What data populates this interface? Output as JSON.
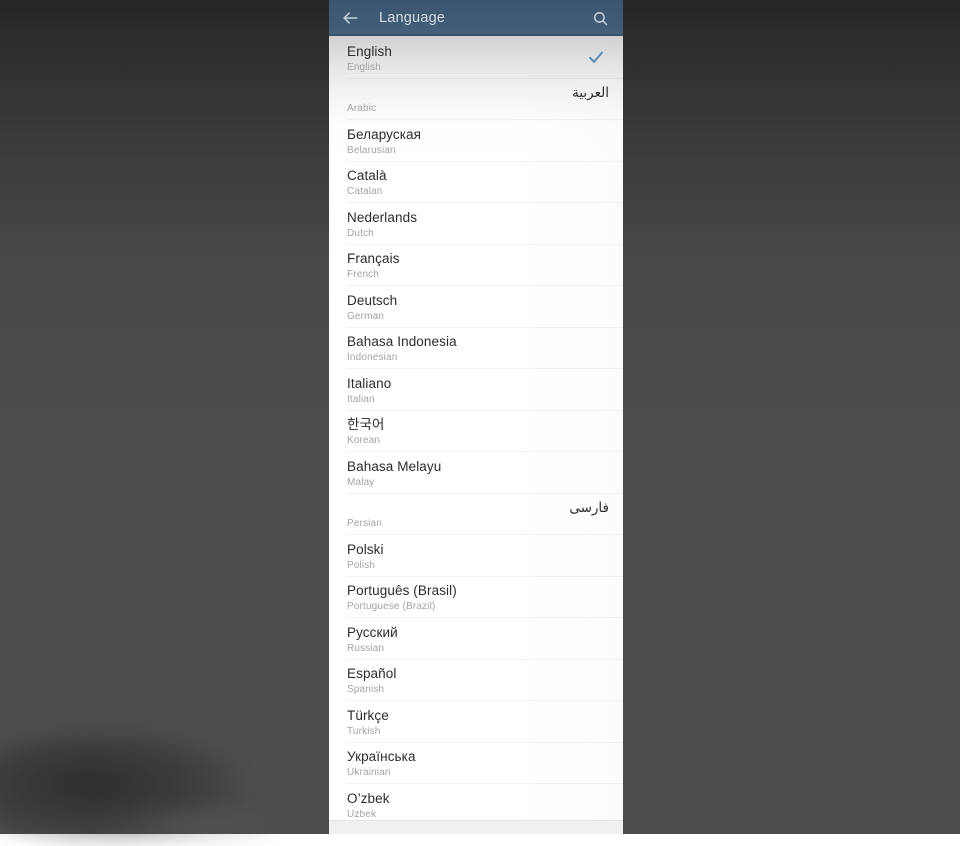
{
  "appbar": {
    "back_icon": "arrow-left-icon",
    "title": "Language",
    "search_icon": "search-icon",
    "background_color": "#3f5a75",
    "title_color": "#d7dde3"
  },
  "selection": {
    "check_icon": "check-icon",
    "check_color": "#5b8cb8",
    "selected_index": 0
  },
  "list": {
    "items": [
      {
        "native": "English",
        "english": "English",
        "selected": true,
        "rtl": false
      },
      {
        "native": "العربية",
        "english": "Arabic",
        "selected": false,
        "rtl": true
      },
      {
        "native": "Беларуская",
        "english": "Belarusian",
        "selected": false,
        "rtl": false
      },
      {
        "native": "Català",
        "english": "Catalan",
        "selected": false,
        "rtl": false
      },
      {
        "native": "Nederlands",
        "english": "Dutch",
        "selected": false,
        "rtl": false
      },
      {
        "native": "Français",
        "english": "French",
        "selected": false,
        "rtl": false
      },
      {
        "native": "Deutsch",
        "english": "German",
        "selected": false,
        "rtl": false
      },
      {
        "native": "Bahasa Indonesia",
        "english": "Indonesian",
        "selected": false,
        "rtl": false
      },
      {
        "native": "Italiano",
        "english": "Italian",
        "selected": false,
        "rtl": false
      },
      {
        "native": "한국어",
        "english": "Korean",
        "selected": false,
        "rtl": false
      },
      {
        "native": "Bahasa Melayu",
        "english": "Malay",
        "selected": false,
        "rtl": false
      },
      {
        "native": "فارسی",
        "english": "Persian",
        "selected": false,
        "rtl": true
      },
      {
        "native": "Polski",
        "english": "Polish",
        "selected": false,
        "rtl": false
      },
      {
        "native": "Português (Brasil)",
        "english": "Portuguese (Brazil)",
        "selected": false,
        "rtl": false
      },
      {
        "native": "Русский",
        "english": "Russian",
        "selected": false,
        "rtl": false
      },
      {
        "native": "Español",
        "english": "Spanish",
        "selected": false,
        "rtl": false
      },
      {
        "native": "Türkçe",
        "english": "Turkish",
        "selected": false,
        "rtl": false
      },
      {
        "native": "Українська",
        "english": "Ukrainian",
        "selected": false,
        "rtl": false
      },
      {
        "native": "O’zbek",
        "english": "Uzbek",
        "selected": false,
        "rtl": false
      }
    ]
  },
  "backdrop": {
    "description": "blurred dark desktop behind the phone screen",
    "color_top": "#232527",
    "color_bottom": "#4c4d4e"
  }
}
